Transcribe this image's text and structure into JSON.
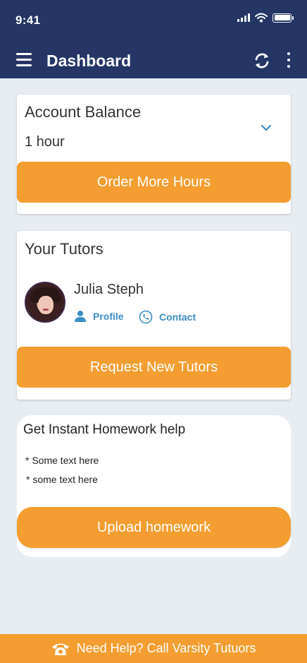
{
  "status_bar": {
    "time": "9:41"
  },
  "header": {
    "title": "Dashboard"
  },
  "account_balance": {
    "title": "Account Balance",
    "value": "1 hour",
    "button_label": "Order More Hours"
  },
  "tutors": {
    "title": "Your Tutors",
    "items": [
      {
        "name": "Julia Steph",
        "profile_label": "Profile",
        "contact_label": "Contact"
      }
    ],
    "button_label": "Request New Tutors"
  },
  "homework": {
    "title": "Get Instant Homework help",
    "lines": [
      "* Some text here",
      "* some text here"
    ],
    "button_label": "Upload homework"
  },
  "footer": {
    "label": "Need Help? Call Varsity Tutuors"
  },
  "colors": {
    "header_bg": "#253565",
    "accent": "#f49d31",
    "link": "#3a8dc4",
    "page_bg": "#e8edf2"
  }
}
